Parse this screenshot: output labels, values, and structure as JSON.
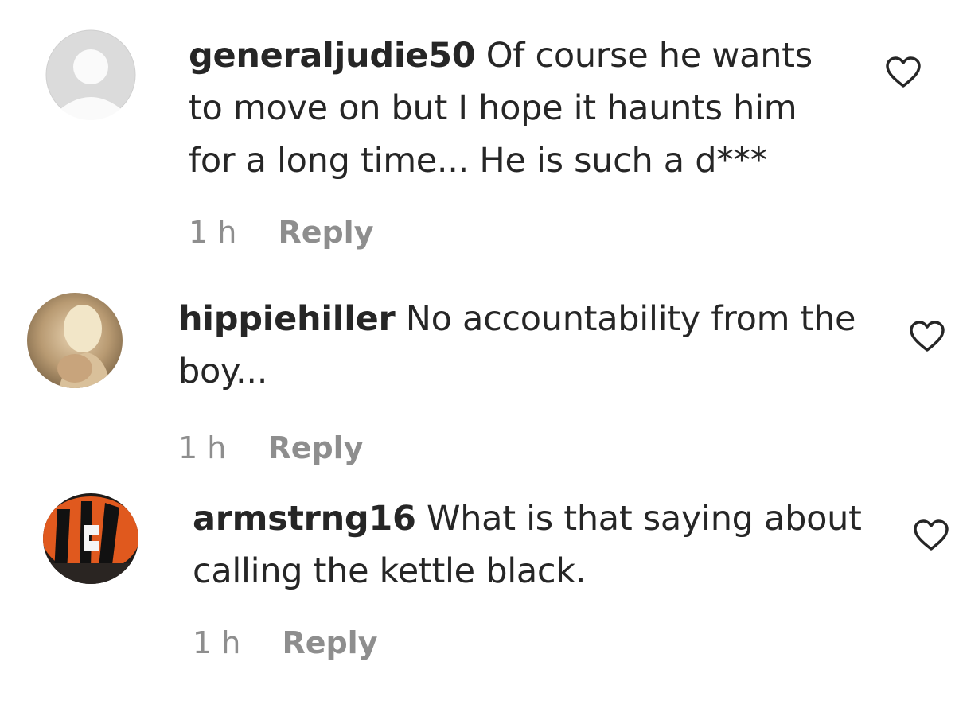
{
  "comments": [
    {
      "username": "generaljudie50",
      "text": "Of course he wants to move on but I hope it haunts him for a long time... He is such a d***",
      "time": "1 h",
      "reply_label": "Reply",
      "avatar_icon": "default-avatar-icon",
      "like_icon": "heart-icon"
    },
    {
      "username": "hippiehiller",
      "text": "No accountability from the boy...",
      "time": "1 h",
      "reply_label": "Reply",
      "avatar_icon": "photo-avatar",
      "like_icon": "heart-icon"
    },
    {
      "username": "armstrng16",
      "text": "What is that saying about calling the kettle black.",
      "time": "1 h",
      "reply_label": "Reply",
      "avatar_icon": "bengals-helmet-avatar",
      "like_icon": "heart-icon"
    }
  ],
  "colors": {
    "text": "#262626",
    "secondary": "#8e8e8e",
    "background": "#ffffff"
  }
}
